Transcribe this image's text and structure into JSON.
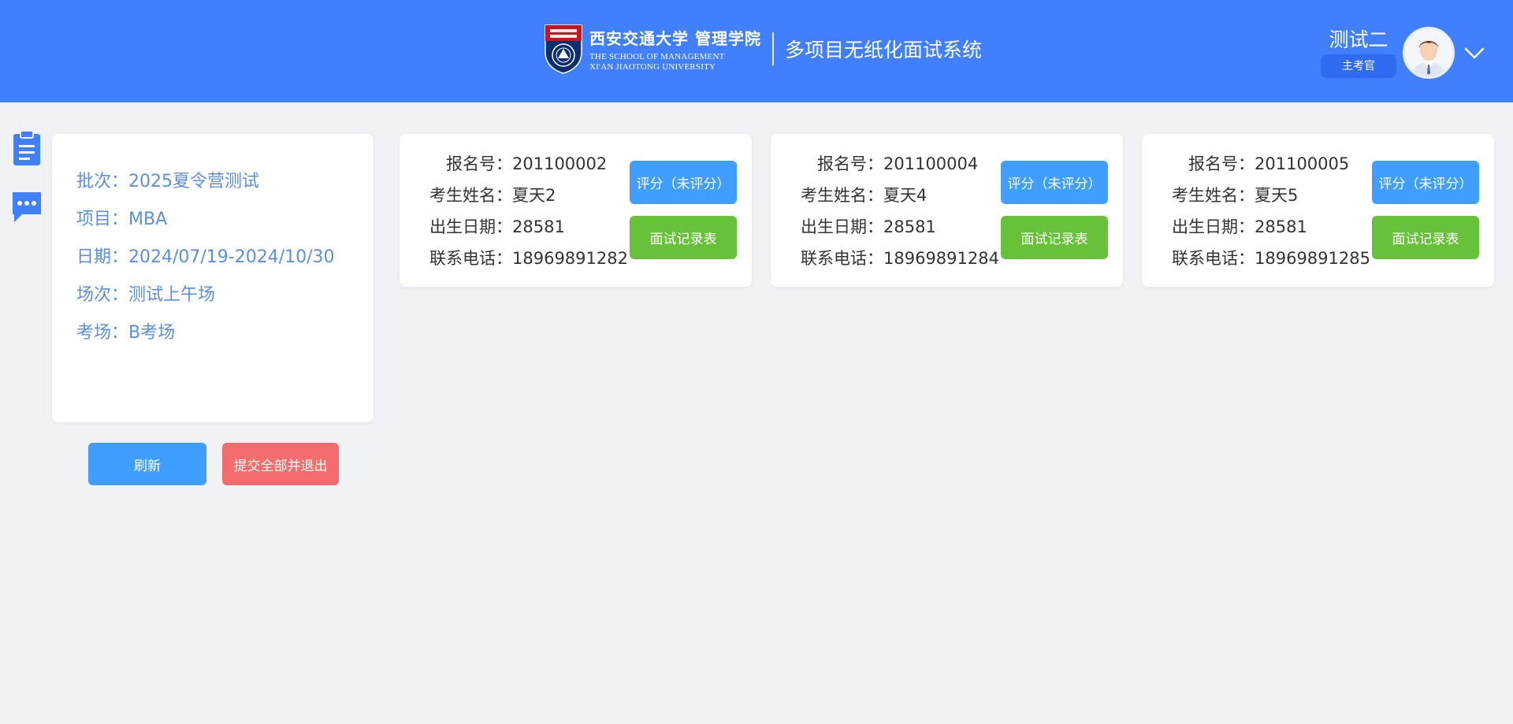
{
  "header": {
    "brand_cn_name": "西安交通大学",
    "brand_cn_school": "管理学院",
    "brand_en_line1": "THE SCHOOL OF MANAGEMENT",
    "brand_en_line2": "XI'AN JIAOTONG UNIVERSITY",
    "system_title": "多项目无纸化面试系统",
    "colors": {
      "background": "#4080ff"
    }
  },
  "user": {
    "name": "测试二",
    "role": "主考官",
    "menu_icon": "chevron-down-icon"
  },
  "side_icons": [
    "clipboard-icon",
    "chat-icon"
  ],
  "info": {
    "batch": "批次：2025夏令营测试",
    "project": "项目：MBA",
    "date": "日期：2024/07/19-2024/10/30",
    "session": "场次：测试上午场",
    "room": "考场：B考场"
  },
  "actions": {
    "refresh": "刷新",
    "submit_all_exit": "提交全部并退出"
  },
  "labels": {
    "reg_no": "报名号：",
    "name": "考生姓名：",
    "birth": "出生日期：",
    "phone": "联系电话："
  },
  "candidates": [
    {
      "reg_no": "201100002",
      "name": "夏天2",
      "birth": "28581",
      "phone": "18969891282",
      "score_label": "评分（未评分）",
      "record_label": "面试记录表"
    },
    {
      "reg_no": "201100004",
      "name": "夏天4",
      "birth": "28581",
      "phone": "18969891284",
      "score_label": "评分（未评分）",
      "record_label": "面试记录表"
    },
    {
      "reg_no": "201100005",
      "name": "夏天5",
      "birth": "28581",
      "phone": "18969891285",
      "score_label": "评分（未评分）",
      "record_label": "面试记录表"
    }
  ],
  "colors": {
    "primary_button": "#409eff",
    "danger_button": "#f56c6c",
    "success_button": "#67c23a",
    "info_text": "#5b8fe0"
  }
}
